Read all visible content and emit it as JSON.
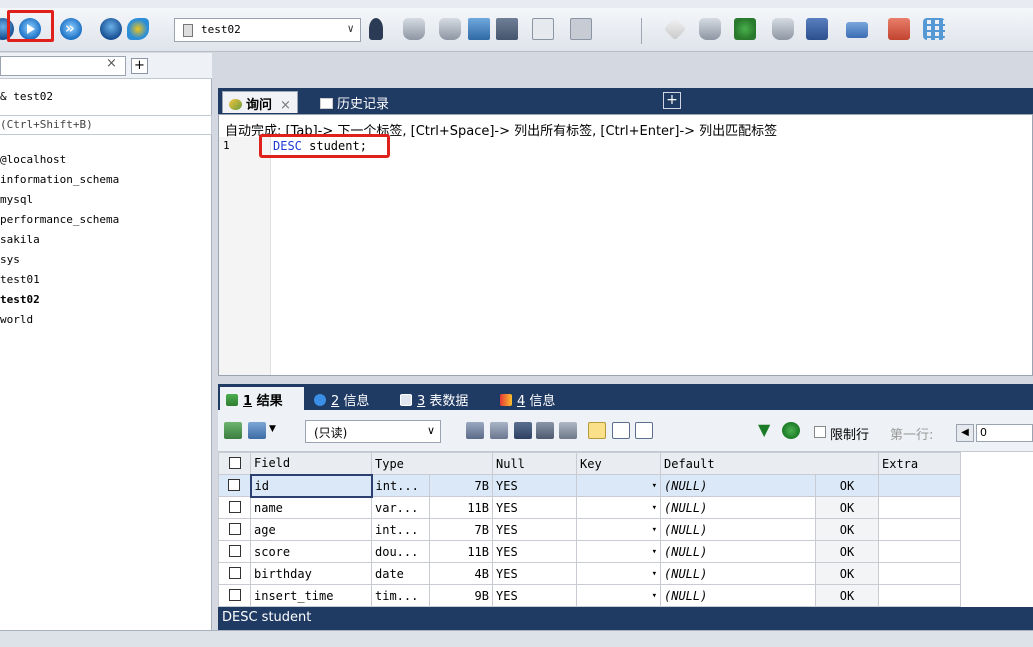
{
  "toolbar": {
    "database_select": "test02"
  },
  "object_browser": {
    "filter_placeholder": "",
    "connection_label": "test02",
    "hint": "(Ctrl+Shift+B)",
    "databases": [
      "@localhost",
      "information_schema",
      "mysql",
      "performance_schema",
      "sakila",
      "sys",
      "test01",
      "test02",
      "world"
    ],
    "selected_database": "test02"
  },
  "query_tabs": [
    {
      "label": "询问",
      "close": "×"
    },
    {
      "label": "历史记录"
    }
  ],
  "editor": {
    "autocomplete_hint": "自动完成: [Tab]-> 下一个标签, [Ctrl+Space]-> 列出所有标签, [Ctrl+Enter]-> 列出匹配标签",
    "line_number": "1",
    "sql_keyword": "DESC",
    "sql_rest": " student;"
  },
  "result_tabs": [
    {
      "num": "1",
      "label": "结果"
    },
    {
      "num": "2",
      "label": "信息"
    },
    {
      "num": "3",
      "label": "表数据"
    },
    {
      "num": "4",
      "label": "信息"
    }
  ],
  "result_toolbar": {
    "mode": "(只读)",
    "limit_label": "限制行",
    "first_row_label": "第一行:",
    "first_row_value": "0"
  },
  "result_grid": {
    "columns": [
      "Field",
      "Type",
      "",
      "Null",
      "Key",
      "Default",
      "",
      "Extra"
    ],
    "rows": [
      {
        "field": "id",
        "type": "int...",
        "size": "7B",
        "null": "YES",
        "key": "",
        "default": "(NULL)",
        "ok": "OK",
        "extra": ""
      },
      {
        "field": "name",
        "type": "var...",
        "size": "11B",
        "null": "YES",
        "key": "",
        "default": "(NULL)",
        "ok": "OK",
        "extra": ""
      },
      {
        "field": "age",
        "type": "int...",
        "size": "7B",
        "null": "YES",
        "key": "",
        "default": "(NULL)",
        "ok": "OK",
        "extra": ""
      },
      {
        "field": "score",
        "type": "dou...",
        "size": "11B",
        "null": "YES",
        "key": "",
        "default": "(NULL)",
        "ok": "OK",
        "extra": ""
      },
      {
        "field": "birthday",
        "type": "date",
        "size": "4B",
        "null": "YES",
        "key": "",
        "default": "(NULL)",
        "ok": "OK",
        "extra": ""
      },
      {
        "field": "insert_time",
        "type": "tim...",
        "size": "9B",
        "null": "YES",
        "key": "",
        "default": "(NULL)",
        "ok": "OK",
        "extra": ""
      }
    ]
  },
  "status_sql": "DESC student"
}
